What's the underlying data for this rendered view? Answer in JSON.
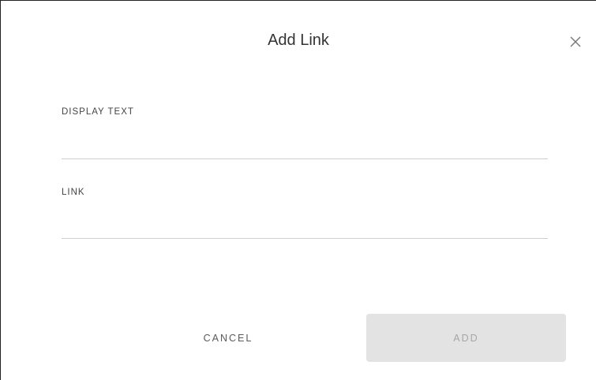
{
  "dialog": {
    "title": "Add Link",
    "close_icon": "close-icon"
  },
  "fields": {
    "display_text": {
      "label": "DISPLAY TEXT",
      "value": "",
      "placeholder": ""
    },
    "link": {
      "label": "LINK",
      "value": "",
      "placeholder": ""
    }
  },
  "actions": {
    "cancel_label": "CANCEL",
    "add_label": "ADD",
    "add_enabled": false
  },
  "colors": {
    "add_button_bg": "#e3e3e3",
    "add_button_text": "#a6a6a6",
    "underline": "#cfcfcf"
  }
}
